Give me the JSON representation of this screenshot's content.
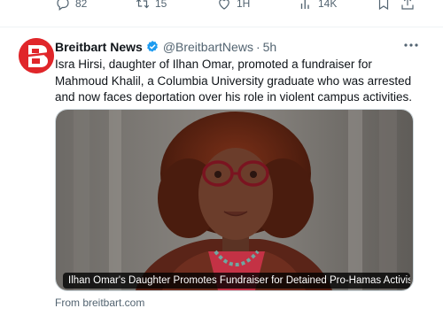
{
  "previous_tweet": {
    "reply_count": "82",
    "retweet_count": "15",
    "like_count": "1H",
    "view_count": "14K"
  },
  "tweet": {
    "author_name": "Breitbart News",
    "handle": "@BreitbartNews",
    "separator": "·",
    "timestamp": "5h",
    "text": "Isra Hirsi, daughter of Ilhan Omar, promoted a fundraiser for Mahmoud Khalil, a Columbia University graduate who was arrested and now faces deportation over his role in violent campus activities.",
    "card": {
      "caption": "Ilhan Omar's Daughter Promotes Fundraiser for Detained Pro-Hamas Activist ...",
      "source": "From breitbart.com"
    }
  },
  "colors": {
    "brand_red": "#e0262a",
    "verified_blue": "#1d9bf0",
    "secondary_text": "#536471"
  },
  "icons": [
    "reply-icon",
    "retweet-icon",
    "like-icon",
    "views-icon",
    "bookmark-icon",
    "share-icon",
    "verified-badge-icon",
    "more-options-icon"
  ]
}
